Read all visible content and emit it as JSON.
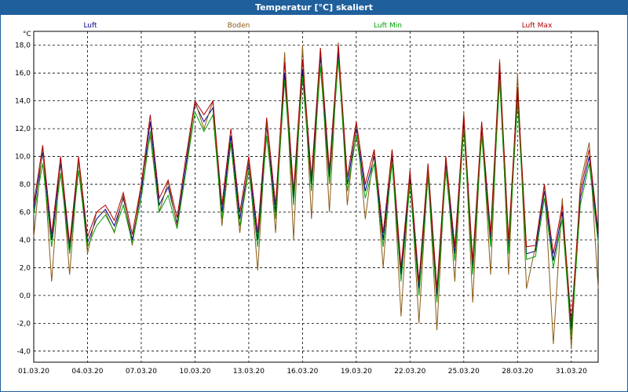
{
  "window": {
    "title": "Temperatur [°C] skaliert"
  },
  "chart_data": {
    "type": "line",
    "title": "Temperatur [°C] skaliert",
    "ylabel": "°C",
    "xlabel": "",
    "ylim": [
      -4.8,
      19.0
    ],
    "yticks": [
      "18,0",
      "16,0",
      "14,0",
      "12,0",
      "10,0",
      "8,0",
      "6,0",
      "4,0",
      "2,0",
      "0,0",
      "-2,0",
      "-4,0"
    ],
    "ytick_values": [
      18,
      16,
      14,
      12,
      10,
      8,
      6,
      4,
      2,
      0,
      -2,
      -4
    ],
    "xticks": [
      "01.03.20",
      "04.03.20",
      "07.03.20",
      "10.03.20",
      "13.03.20",
      "16.03.20",
      "19.03.20",
      "22.03.20",
      "25.03.20",
      "28.03.20",
      "31.03.20"
    ],
    "xtick_days": [
      0,
      3,
      6,
      9,
      12,
      15,
      18,
      21,
      24,
      27,
      30
    ],
    "x_days_range": [
      0,
      31.5
    ],
    "grid": true,
    "legend_position": "top",
    "series": [
      {
        "name": "Luft",
        "color": "#00008b",
        "x": [
          0,
          0.5,
          1,
          1.5,
          2,
          2.5,
          3,
          3.5,
          4,
          4.5,
          5,
          5.5,
          6,
          6.5,
          7,
          7.5,
          8,
          8.5,
          9,
          9.5,
          10,
          10.5,
          11,
          11.5,
          12,
          12.5,
          13,
          13.5,
          14,
          14.5,
          15,
          15.5,
          16,
          16.5,
          17,
          17.5,
          18,
          18.5,
          19,
          19.5,
          20,
          20.5,
          21,
          21.5,
          22,
          22.5,
          23,
          23.5,
          24,
          24.5,
          25,
          25.5,
          26,
          26.5,
          27,
          27.5,
          28,
          28.5,
          29,
          29.5,
          30,
          30.5,
          31,
          31.5
        ],
        "values": [
          6.2,
          10.3,
          4.0,
          9.5,
          3.3,
          9.7,
          3.8,
          5.5,
          6.2,
          5.0,
          7.0,
          4.0,
          7.5,
          12.5,
          6.5,
          7.8,
          5.2,
          9.5,
          13.8,
          12.5,
          13.5,
          6.0,
          11.5,
          5.5,
          9.5,
          4.0,
          12.2,
          6.0,
          16.0,
          7.0,
          16.2,
          8.0,
          17.2,
          8.5,
          17.5,
          8.0,
          12.0,
          7.5,
          10.0,
          4.0,
          10.0,
          1.5,
          8.5,
          0.5,
          9.0,
          0.0,
          9.5,
          3.0,
          12.5,
          2.0,
          12.0,
          4.0,
          16.2,
          3.5,
          14.5,
          3.0,
          3.2,
          7.5,
          2.5,
          6.0,
          -2.5,
          7.0,
          10.0,
          4.2
        ]
      },
      {
        "name": "Boden",
        "color": "#8b5a14",
        "x": [
          0,
          0.5,
          1,
          1.5,
          2,
          2.5,
          3,
          3.5,
          4,
          4.5,
          5,
          5.5,
          6,
          6.5,
          7,
          7.5,
          8,
          8.5,
          9,
          9.5,
          10,
          10.5,
          11,
          11.5,
          12,
          12.5,
          13,
          13.5,
          14,
          14.5,
          15,
          15.5,
          16,
          16.5,
          17,
          17.5,
          18,
          18.5,
          19,
          19.5,
          20,
          20.5,
          21,
          21.5,
          22,
          22.5,
          23,
          23.5,
          24,
          24.5,
          25,
          25.5,
          26,
          26.5,
          27,
          27.5,
          28,
          28.5,
          29,
          29.5,
          30,
          30.5,
          31,
          31.5
        ],
        "values": [
          4.2,
          10.8,
          1.0,
          10.0,
          1.5,
          9.8,
          3.0,
          6.0,
          6.0,
          4.5,
          7.2,
          3.6,
          8.0,
          11.5,
          6.0,
          8.2,
          5.0,
          9.0,
          14.0,
          12.0,
          14.0,
          5.0,
          11.0,
          4.5,
          9.8,
          1.8,
          12.5,
          4.5,
          17.5,
          4.0,
          18.0,
          5.5,
          17.8,
          6.0,
          18.2,
          6.5,
          12.5,
          5.5,
          10.5,
          2.0,
          10.5,
          -1.5,
          9.0,
          -2.0,
          9.0,
          -2.5,
          10.0,
          1.0,
          13.2,
          -0.5,
          12.5,
          1.5,
          17.0,
          1.5,
          16.0,
          0.5,
          3.5,
          8.0,
          -3.5,
          7.0,
          -3.8,
          8.0,
          11.0,
          0.5
        ]
      },
      {
        "name": "Luft Min",
        "color": "#00a000",
        "x": [
          0,
          0.5,
          1,
          1.5,
          2,
          2.5,
          3,
          3.5,
          4,
          4.5,
          5,
          5.5,
          6,
          6.5,
          7,
          7.5,
          8,
          8.5,
          9,
          9.5,
          10,
          10.5,
          11,
          11.5,
          12,
          12.5,
          13,
          13.5,
          14,
          14.5,
          15,
          15.5,
          16,
          16.5,
          17,
          17.5,
          18,
          18.5,
          19,
          19.5,
          20,
          20.5,
          21,
          21.5,
          22,
          22.5,
          23,
          23.5,
          24,
          24.5,
          25,
          25.5,
          26,
          26.5,
          27,
          27.5,
          28,
          28.5,
          29,
          29.5,
          30,
          30.5,
          31,
          31.5
        ],
        "values": [
          5.8,
          9.5,
          3.5,
          8.8,
          3.0,
          9.0,
          3.5,
          5.0,
          5.8,
          4.6,
          6.5,
          3.8,
          7.0,
          11.8,
          6.0,
          7.2,
          4.8,
          9.0,
          13.2,
          11.8,
          13.0,
          5.5,
          11.0,
          5.0,
          9.0,
          3.5,
          11.5,
          5.5,
          15.5,
          6.5,
          15.8,
          7.5,
          16.5,
          8.0,
          17.0,
          7.5,
          11.5,
          7.0,
          9.5,
          3.5,
          9.5,
          1.0,
          8.0,
          0.0,
          8.5,
          -0.5,
          9.0,
          2.5,
          12.0,
          1.5,
          11.5,
          3.5,
          15.5,
          3.0,
          14.0,
          2.6,
          2.8,
          7.0,
          2.0,
          5.5,
          -3.0,
          6.5,
          9.5,
          3.8
        ]
      },
      {
        "name": "Luft Max",
        "color": "#b00000",
        "x": [
          0,
          0.5,
          1,
          1.5,
          2,
          2.5,
          3,
          3.5,
          4,
          4.5,
          5,
          5.5,
          6,
          6.5,
          7,
          7.5,
          8,
          8.5,
          9,
          9.5,
          10,
          10.5,
          11,
          11.5,
          12,
          12.5,
          13,
          13.5,
          14,
          14.5,
          15,
          15.5,
          16,
          16.5,
          17,
          17.5,
          18,
          18.5,
          19,
          19.5,
          20,
          20.5,
          21,
          21.5,
          22,
          22.5,
          23,
          23.5,
          24,
          24.5,
          25,
          25.5,
          26,
          26.5,
          27,
          27.5,
          28,
          28.5,
          29,
          29.5,
          30,
          30.5,
          31,
          31.5
        ],
        "values": [
          6.6,
          10.8,
          4.4,
          10.0,
          3.7,
          10.0,
          4.2,
          6.0,
          6.5,
          5.4,
          7.4,
          4.4,
          8.0,
          13.0,
          7.0,
          8.3,
          5.6,
          10.0,
          14.0,
          13.0,
          14.0,
          6.5,
          12.0,
          6.0,
          10.0,
          4.5,
          12.8,
          6.5,
          16.8,
          7.5,
          17.0,
          8.5,
          17.8,
          9.0,
          18.0,
          8.5,
          12.5,
          8.0,
          10.5,
          4.5,
          10.5,
          2.0,
          9.0,
          1.0,
          9.5,
          0.5,
          10.0,
          3.5,
          13.0,
          2.5,
          12.5,
          4.5,
          16.8,
          4.0,
          15.0,
          3.5,
          3.6,
          8.0,
          3.0,
          6.5,
          -2.0,
          7.5,
          10.5,
          4.6
        ]
      }
    ]
  }
}
